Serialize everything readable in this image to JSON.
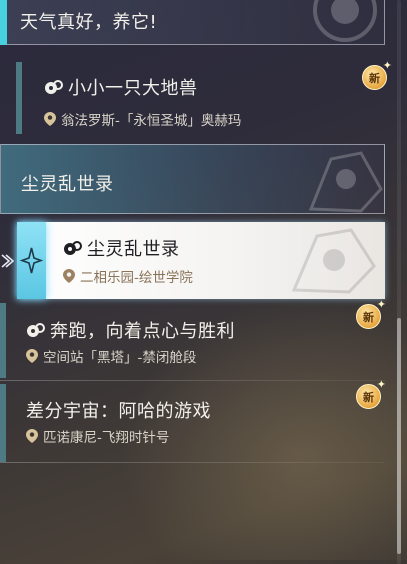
{
  "quests": [
    {
      "title": "天气真好，养它!"
    },
    {
      "title": "小小一只大地兽",
      "location": "翁法罗斯-「永恒圣城」奥赫玛",
      "badge": "新"
    },
    {
      "title": "尘灵乱世录",
      "location": "二相乐园-绘世学院"
    },
    {
      "title": "奔跑，向着点心与胜利",
      "location": "空间站「黑塔」-禁闭舱段",
      "badge": "新"
    },
    {
      "title": "差分宇宙：阿哈的游戏",
      "location": "匹诺康尼-飞翔时针号",
      "badge": "新"
    }
  ],
  "group": {
    "title": "尘灵乱世录"
  },
  "selected_index": 2,
  "colors": {
    "accent": "#48d2e0",
    "selected_bg": "#ffffff",
    "badge": "#e7a640"
  },
  "icons": [
    "quest-icon",
    "location-pin-icon",
    "new-badge-icon",
    "diamond-icon",
    "arrow-left-icon"
  ]
}
